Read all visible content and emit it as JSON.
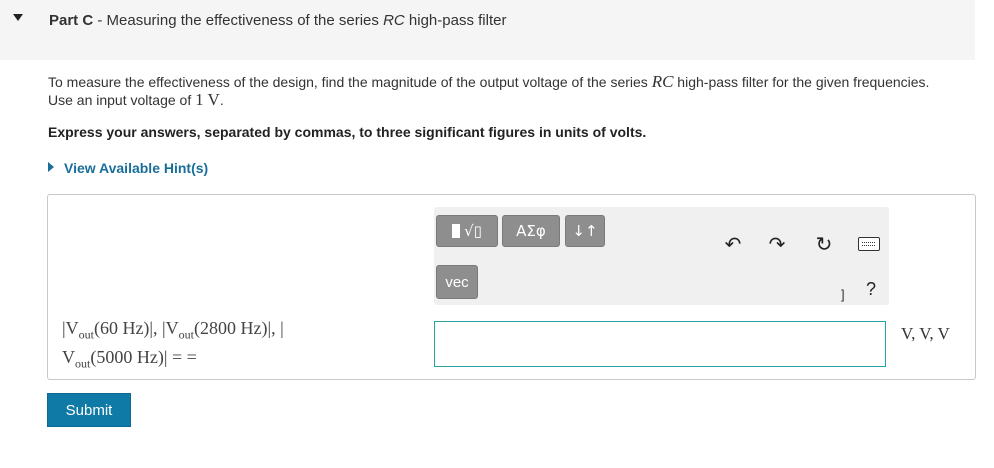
{
  "part": {
    "label": "Part C",
    "separator": " - ",
    "title_prefix": "Measuring the effectiveness of the series ",
    "title_rc": "RC",
    "title_suffix": " high-pass filter"
  },
  "instructions": {
    "text_before_rc": "To measure the effectiveness of the design, find the magnitude of the output voltage of the series ",
    "rc": "RC",
    "text_after_rc": " high-pass filter for the given frequencies. Use an input voltage of ",
    "input_value": "1 V",
    "period": "."
  },
  "express": "Express your answers, separated by commas, to three significant figures in units of volts.",
  "hint": {
    "label": "View Available Hint(s)"
  },
  "toolbar": {
    "templates_label": "√▯",
    "symbols_label": "ΑΣφ",
    "sort_label": "↓↑",
    "vec_label": "vec",
    "undo_icon": "undo-icon",
    "redo_icon": "redo-icon",
    "reset_icon": "reset-icon",
    "keyboard_icon": "keyboard-icon",
    "bracket": "]",
    "help": "?"
  },
  "prompt": {
    "v1": "|V",
    "v1_sub": "out",
    "v1_arg": "(60 Hz)|, |V",
    "v2_sub": "out",
    "v2_arg": "(2800 Hz)|, |",
    "v3": "V",
    "v3_sub": "out",
    "v3_arg": "(5000 Hz)|",
    "equals": " = ="
  },
  "answer": {
    "value": "",
    "units": "V, V, V"
  },
  "submit": {
    "label": "Submit"
  },
  "colors": {
    "accent": "#0f7aa6",
    "link": "#1a6f9a",
    "input_border": "#2aa0a0"
  }
}
